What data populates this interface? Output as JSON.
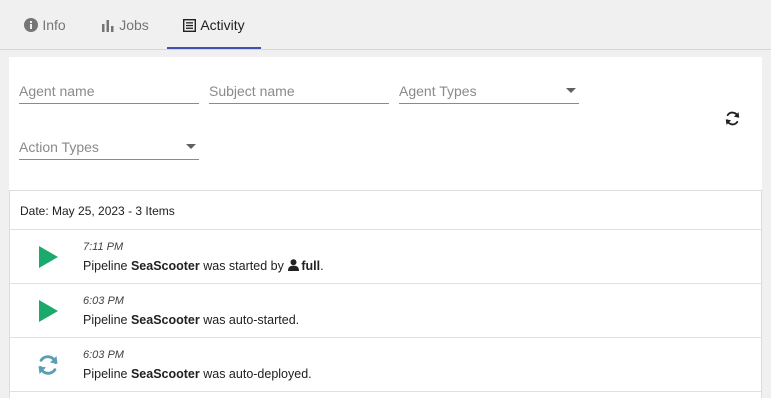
{
  "tabs": [
    {
      "label": "Info",
      "icon": "info-circle-icon"
    },
    {
      "label": "Jobs",
      "icon": "bar-chart-icon"
    },
    {
      "label": "Activity",
      "icon": "list-document-icon",
      "active": true
    }
  ],
  "filters": {
    "agent_name_placeholder": "Agent name",
    "subject_name_placeholder": "Subject name",
    "agent_types_label": "Agent Types",
    "action_types_label": "Action Types",
    "refresh_icon": "refresh-icon"
  },
  "activity": {
    "date_header": "Date: May 25, 2023 - 3 Items",
    "items": [
      {
        "icon": "play-icon",
        "time": "7:11 PM",
        "prefix": "Pipeline",
        "subject": "SeaScooter",
        "action": "was started by",
        "user": "full",
        "suffix": "."
      },
      {
        "icon": "play-icon",
        "time": "6:03 PM",
        "prefix": "Pipeline",
        "subject": "SeaScooter",
        "action": "was auto-started."
      },
      {
        "icon": "sync-icon",
        "time": "6:03 PM",
        "prefix": "Pipeline",
        "subject": "SeaScooter",
        "action": "was auto-deployed."
      }
    ]
  },
  "colors": {
    "accent": "#3f51b5",
    "play": "#1aaa6b",
    "sync": "#5a9fb2"
  }
}
